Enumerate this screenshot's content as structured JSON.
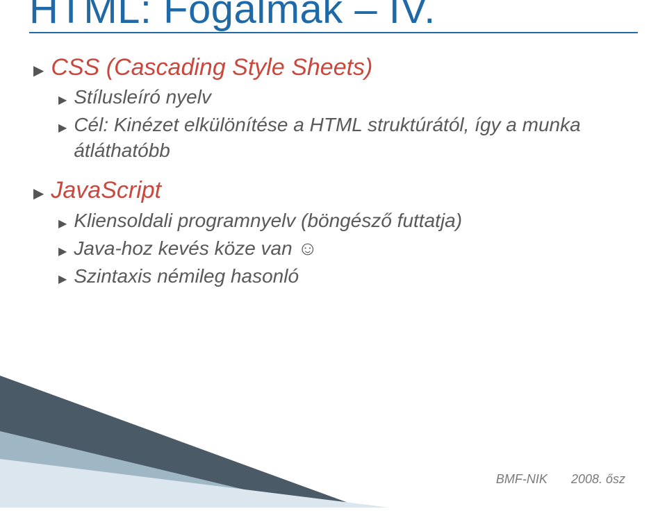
{
  "title": "HTML: Fogalmak – IV.",
  "bullets": [
    {
      "head": "CSS (Cascading Style Sheets)",
      "items": [
        "Stílusleíró nyelv",
        "Cél: Kinézet elkülönítése a HTML struktúrától, így a munka átláthatóbb"
      ]
    },
    {
      "head": "JavaScript",
      "items": [
        "Kliensoldali programnyelv (böngésző futtatja)",
        "Java-hoz kevés köze van ☺",
        "Szintaxis némileg hasonló"
      ]
    }
  ],
  "footer": {
    "org": "BMF-NIK",
    "term": "2008. ősz"
  }
}
